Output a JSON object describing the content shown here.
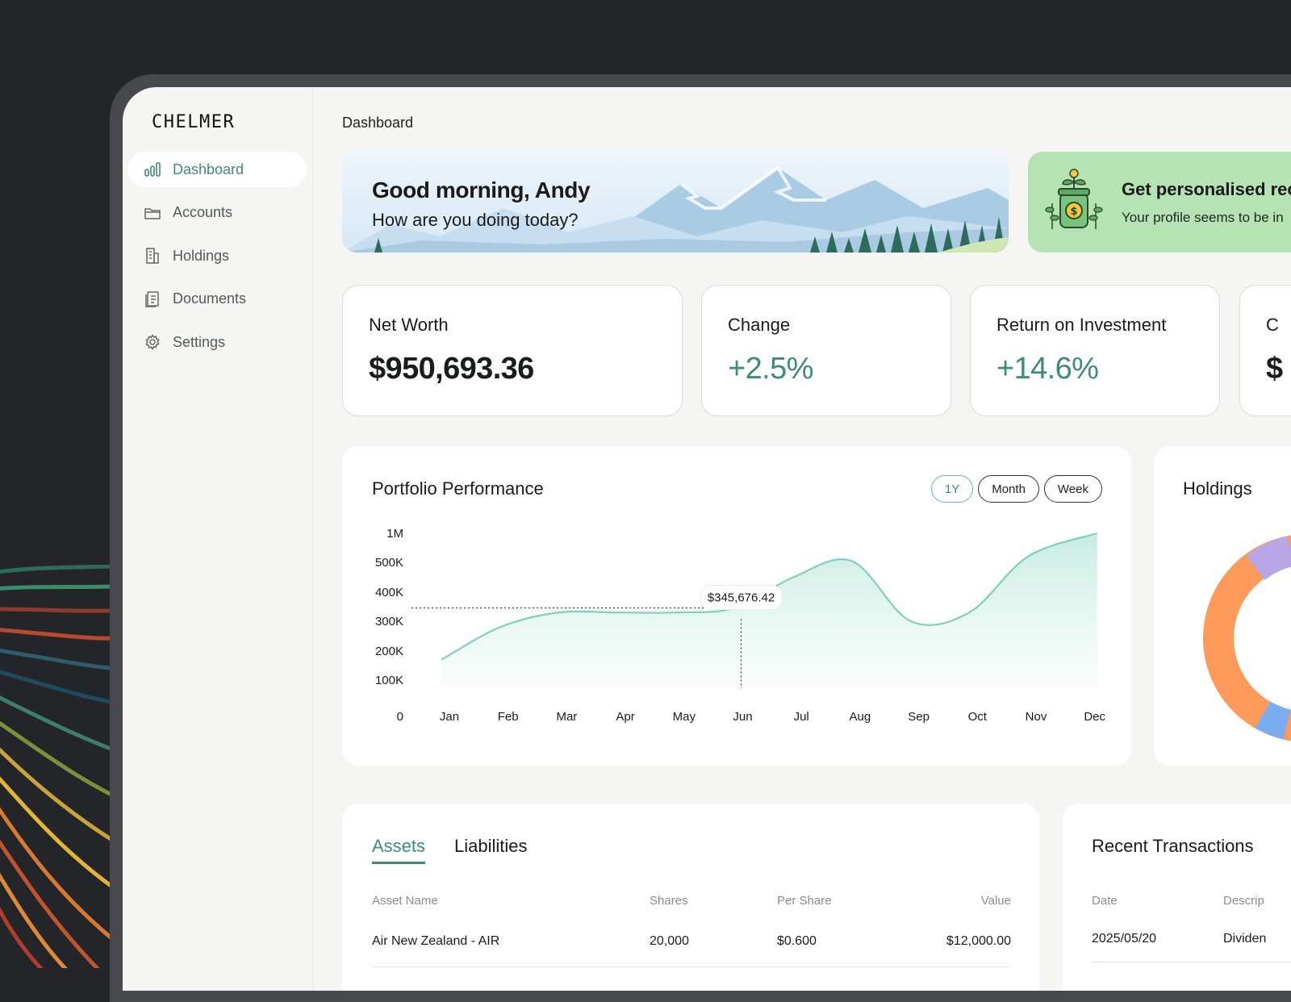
{
  "brand": {
    "logo_text": "CHELMER"
  },
  "sidebar": {
    "items": [
      {
        "label": "Dashboard",
        "icon": "bar-chart-icon",
        "active": true
      },
      {
        "label": "Accounts",
        "icon": "folder-icon"
      },
      {
        "label": "Holdings",
        "icon": "building-icon"
      },
      {
        "label": "Documents",
        "icon": "document-icon"
      },
      {
        "label": "Settings",
        "icon": "gear-icon"
      }
    ]
  },
  "header": {
    "breadcrumb": "Dashboard"
  },
  "greeting": {
    "title": "Good morning, Andy",
    "subtitle": "How are you doing today?"
  },
  "promo": {
    "title": "Get personalised rec",
    "subtitle": "Your profile seems to be in"
  },
  "stats": [
    {
      "label": "Net Worth",
      "value": "$950,693.36"
    },
    {
      "label": "Change",
      "value": "+2.5%"
    },
    {
      "label": "Return on Investment",
      "value": "+14.6%"
    },
    {
      "label": "C",
      "value": "$"
    }
  ],
  "performance": {
    "title": "Portfolio Performance",
    "ranges": [
      "1Y",
      "Month",
      "Week"
    ],
    "active_range": "1Y",
    "tooltip": "$345,676.42"
  },
  "chart_data": {
    "type": "area",
    "title": "Portfolio Performance",
    "categories": [
      "Jan",
      "Feb",
      "Mar",
      "Apr",
      "May",
      "Jun",
      "Jul",
      "Aug",
      "Sep",
      "Oct",
      "Nov",
      "Dec"
    ],
    "y_ticks": [
      "0",
      "100K",
      "200K",
      "300K",
      "400K",
      "500K",
      "1M"
    ],
    "values": [
      170000,
      280000,
      330000,
      330000,
      330000,
      345676.42,
      450000,
      520000,
      300000,
      330000,
      600000,
      1000000
    ],
    "highlight": {
      "category": "Jun",
      "value": 345676.42,
      "label": "$345,676.42"
    },
    "colors": {
      "line": "#7fcdbb",
      "fill": "#d7f2ea"
    }
  },
  "holdings": {
    "title": "Holdings"
  },
  "assets": {
    "tabs": [
      "Assets",
      "Liabilities"
    ],
    "active_tab": "Assets",
    "columns": [
      "Asset Name",
      "Shares",
      "Per Share",
      "Value"
    ],
    "rows": [
      {
        "name": "Air New Zealand - AIR",
        "shares": "20,000",
        "per_share": "$0.600",
        "value": "$12,000.00"
      }
    ]
  },
  "transactions": {
    "title": "Recent Transactions",
    "columns": [
      "Date",
      "Descrip"
    ],
    "rows": [
      {
        "date": "2025/05/20",
        "description": "Dividen"
      }
    ]
  },
  "colors": {
    "accent": "#3e8b77",
    "promo_bg": "#b6e3b4",
    "donut_orange": "#ff9a5a",
    "donut_purple": "#b8a6e6",
    "donut_blue": "#7aaef0"
  }
}
